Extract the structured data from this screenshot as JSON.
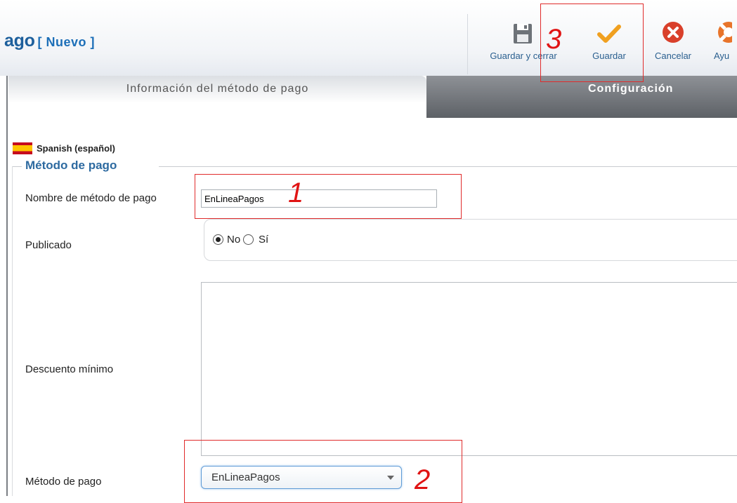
{
  "header": {
    "title": "ago",
    "subtitle": "[ Nuevo ]"
  },
  "toolbar": {
    "save_close_label": "Guardar y cerrar",
    "save_label": "Guardar",
    "cancel_label": "Cancelar",
    "help_label": "Ayu"
  },
  "tabs": [
    {
      "label": "Información del método de pago",
      "active": true
    },
    {
      "label": "Configuración",
      "active": false
    }
  ],
  "language": {
    "label": "Spanish (español)",
    "flag_icon": "spain-flag-icon"
  },
  "fieldset": {
    "legend": "Método de pago"
  },
  "form": {
    "name_label": "Nombre de método de pago",
    "name_value": "EnLineaPagos",
    "published_label": "Publicado",
    "published_options": [
      "No",
      "Sí"
    ],
    "published_selected": "No",
    "min_discount_label": "Descuento mínimo",
    "min_discount_value": "",
    "payment_method_label": "Método de pago",
    "payment_method_value": "EnLineaPagos"
  },
  "annotations": {
    "step1": "1",
    "step2": "2",
    "step3": "3",
    "color": "#e02b2b"
  },
  "colors": {
    "title": "#1d5f9c",
    "legend": "#2d6aa0",
    "save_check": "#f0a020",
    "cancel_red": "#d9402b"
  }
}
